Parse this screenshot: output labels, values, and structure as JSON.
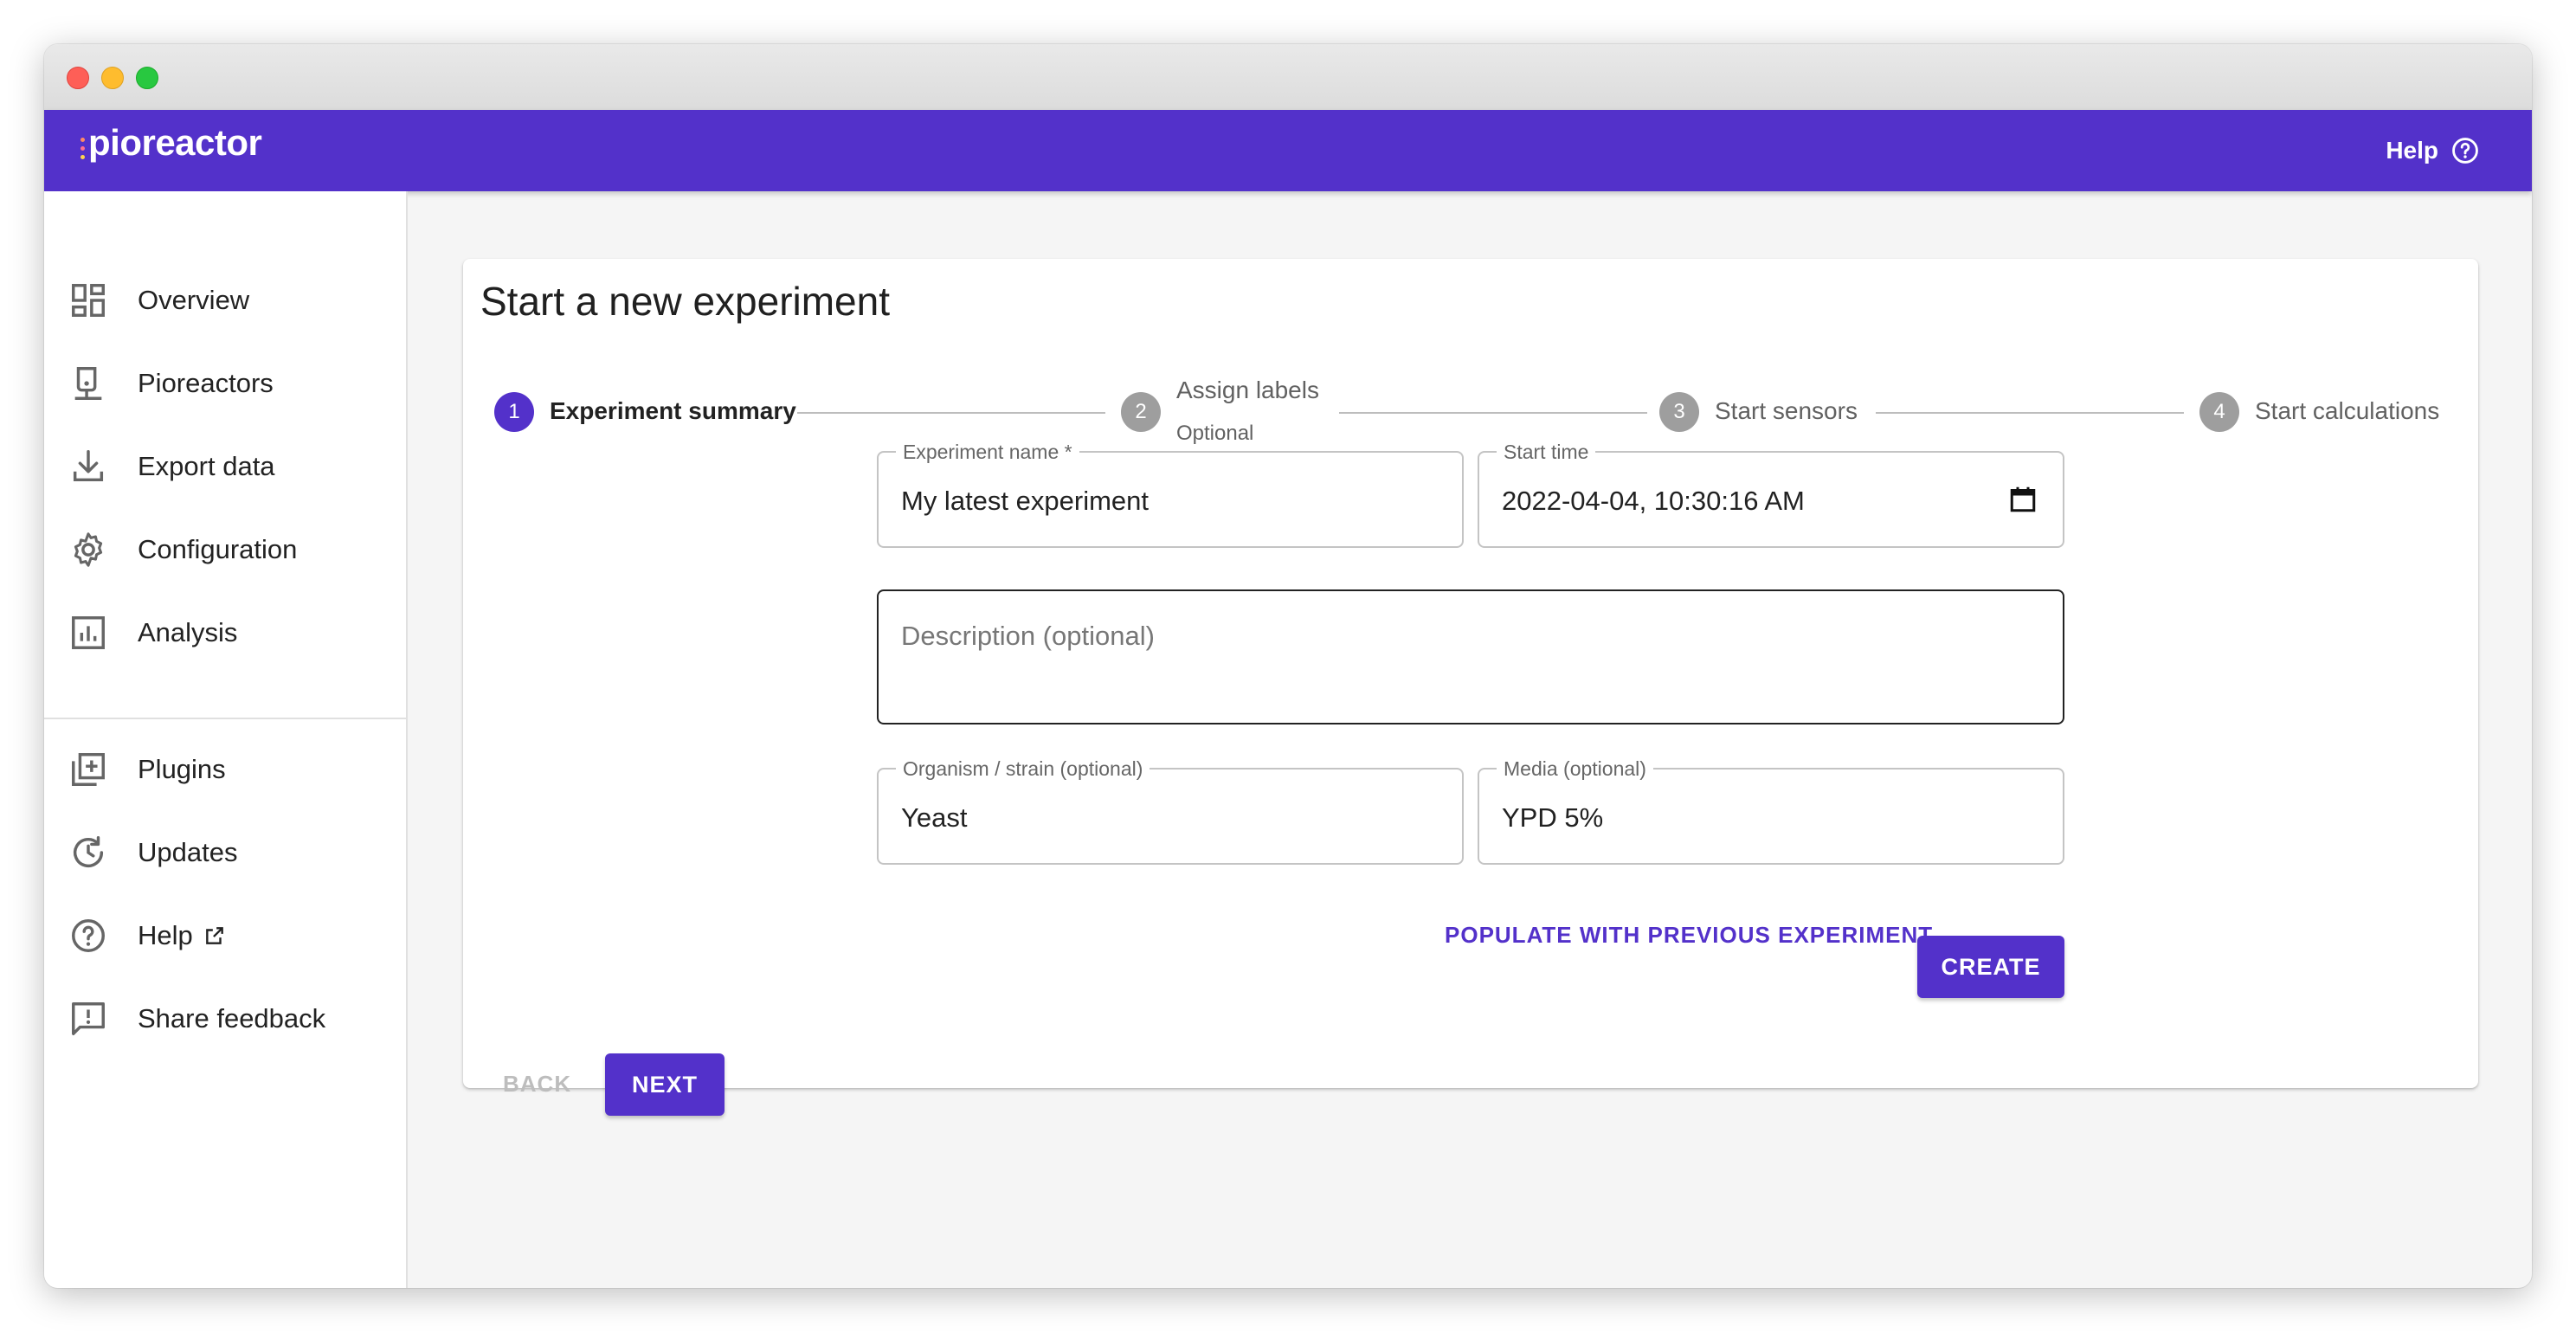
{
  "app": {
    "brand": "pioreactor",
    "help_label": "Help",
    "accent_color": "#5331ca"
  },
  "sidebar": {
    "items": [
      {
        "label": "Overview",
        "icon": "dashboard-icon"
      },
      {
        "label": "Pioreactors",
        "icon": "bioreactor-icon"
      },
      {
        "label": "Export data",
        "icon": "download-icon"
      },
      {
        "label": "Configuration",
        "icon": "gear-icon"
      },
      {
        "label": "Analysis",
        "icon": "bar-chart-icon"
      },
      {
        "label": "Plugins",
        "icon": "plus-box-icon"
      },
      {
        "label": "Updates",
        "icon": "update-icon"
      },
      {
        "label": "Help",
        "icon": "help-circle-icon",
        "external_icon": "external-link-icon"
      },
      {
        "label": "Share feedback",
        "icon": "feedback-icon"
      }
    ]
  },
  "page": {
    "title": "Start a new experiment"
  },
  "stepper": {
    "steps": [
      {
        "number": "1",
        "label": "Experiment summary",
        "sublabel": "",
        "active": true
      },
      {
        "number": "2",
        "label": "Assign labels",
        "sublabel": "Optional",
        "active": false
      },
      {
        "number": "3",
        "label": "Start sensors",
        "sublabel": "",
        "active": false
      },
      {
        "number": "4",
        "label": "Start calculations",
        "sublabel": "",
        "active": false
      }
    ]
  },
  "form": {
    "experiment_name": {
      "label": "Experiment name *",
      "value": "My latest experiment"
    },
    "start_time": {
      "label": "Start time",
      "value": "2022-04-04, 10:30:16 AM"
    },
    "description": {
      "placeholder": "Description (optional)",
      "value": ""
    },
    "organism": {
      "label": "Organism / strain (optional)",
      "value": "Yeast"
    },
    "media": {
      "label": "Media (optional)",
      "value": "YPD 5%"
    },
    "populate_label": "POPULATE WITH PREVIOUS EXPERIMENT",
    "create_label": "CREATE"
  },
  "nav_buttons": {
    "back_label": "BACK",
    "next_label": "NEXT"
  }
}
